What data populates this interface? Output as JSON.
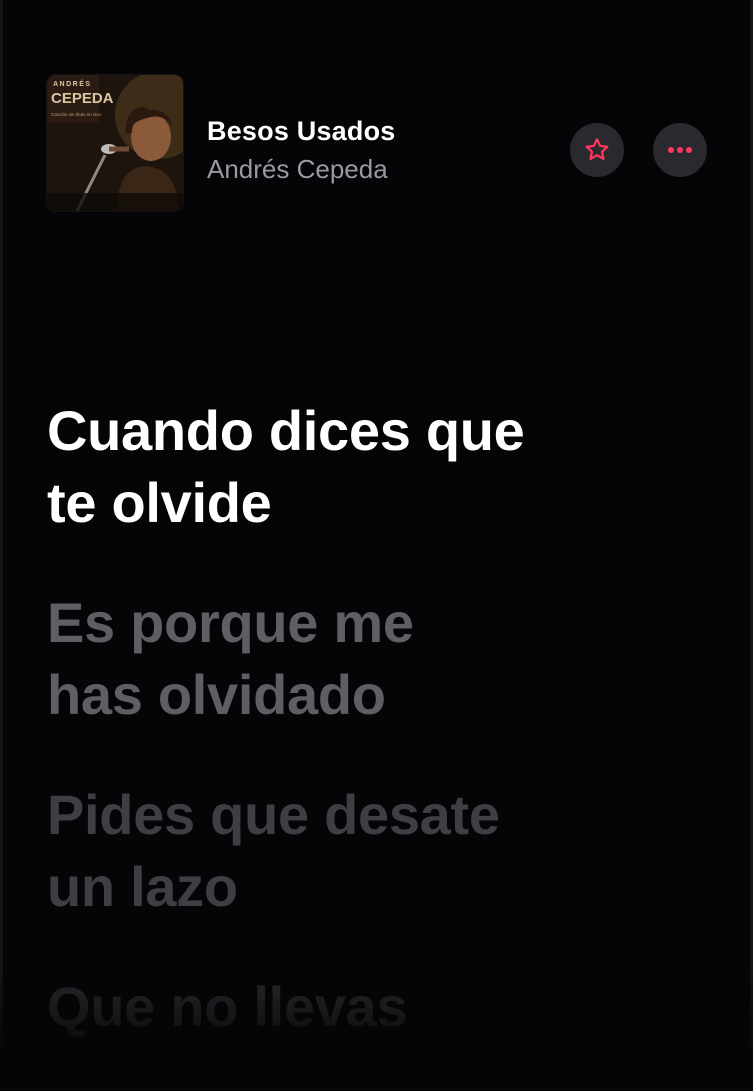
{
  "now_playing": {
    "album_art": {
      "artist_text": "ANDRÉS",
      "name_text": "CEPEDA",
      "subtitle_text": "Canción sin título en vivo"
    },
    "title": "Besos Usados",
    "artist": "Andrés Cepeda",
    "favorite_icon": "star-outline-icon",
    "more_icon": "ellipsis-icon"
  },
  "lyrics": {
    "lines": [
      {
        "text": "Cuando dices que\nte olvide",
        "state": "active"
      },
      {
        "text": "Es porque me\nhas olvidado",
        "state": "upcoming"
      },
      {
        "text": "Pides que desate\nun lazo",
        "state": "upcoming"
      },
      {
        "text": "Que no llevas",
        "state": "upcoming"
      }
    ]
  },
  "colors": {
    "background": "#050507",
    "accent": "#ff375f",
    "button_bg": "#2a2a2e",
    "active_lyric": "#ffffff",
    "artist_text": "#9a999f"
  }
}
